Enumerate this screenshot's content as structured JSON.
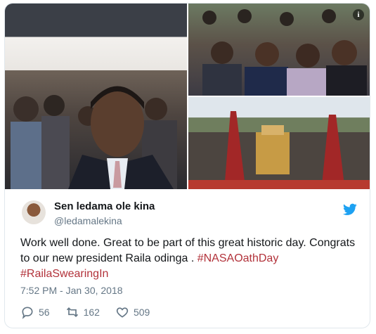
{
  "media": {
    "photo_1_alt": "",
    "photo_2_alt": "",
    "photo_3_alt": "",
    "info_icon": "info-icon"
  },
  "user": {
    "name": "Sen ledama ole kina",
    "handle": "@ledamalekina"
  },
  "tweet": {
    "text_plain": "Work well done. Great to be part of this great historic day. Congrats to our new president Raila odinga .",
    "hashtag_1": "#NASAOathDay",
    "hashtag_2": "#RailaSwearingIn",
    "timestamp": "7:52 PM - Jan 30, 2018"
  },
  "actions": {
    "replies": "56",
    "retweets": "162",
    "likes": "509"
  },
  "colors": {
    "hashtag": "#b2323a",
    "twitter_blue": "#1da1f2",
    "muted": "#657786"
  }
}
